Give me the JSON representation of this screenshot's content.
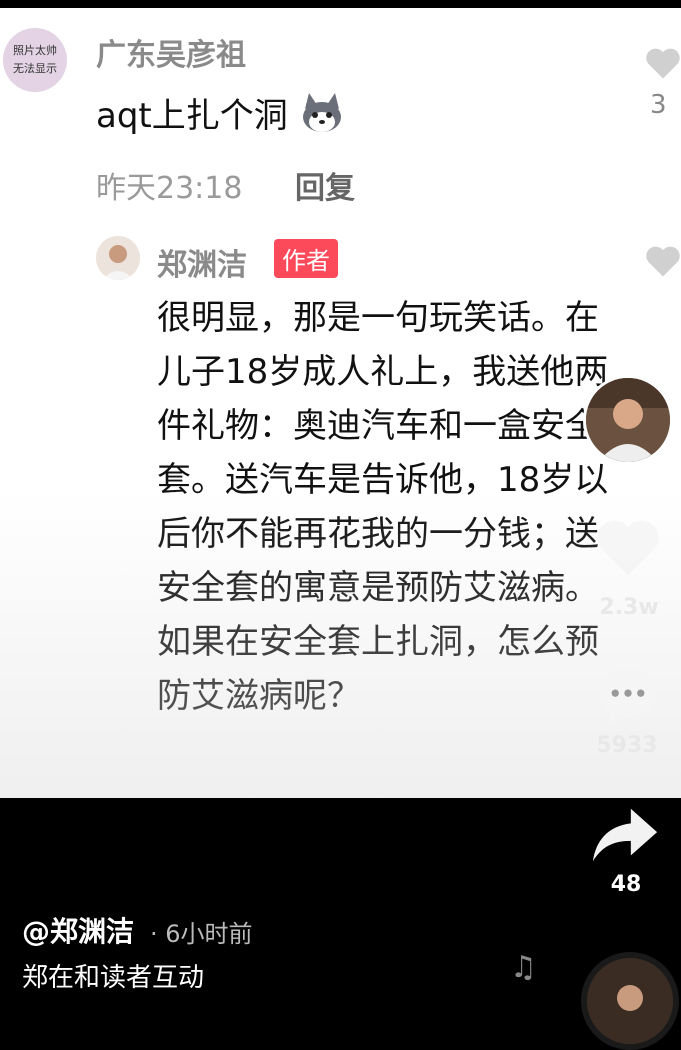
{
  "comment": {
    "avatar_text_line1": "照片太帅",
    "avatar_text_line2": "无法显示",
    "username": "广东吴彦祖",
    "text": "aqt上扎个洞",
    "time": "昨天23:18",
    "reply_label": "回复",
    "like_count": "3"
  },
  "reply": {
    "username": "郑渊洁",
    "badge": "作者",
    "text": "很明显，那是一句玩笑话。在儿子18岁成人礼上，我送他两件礼物：奥迪汽车和一盒安全套。送汽车是告诉他，18岁以后你不能再花我的一分钱；送安全套的寓意是预防艾滋病。如果在安全套上扎洞，怎么预防艾滋病呢？"
  },
  "sidebar": {
    "like_count": "2.3w",
    "comment_count": "5933",
    "share_count": "48"
  },
  "caption": {
    "username": "@郑渊洁",
    "time": "· 6小时前",
    "description": "郑在和读者互动"
  },
  "icons": {
    "comment_like": "heart-icon",
    "emoji": "husky-emoji",
    "video_like": "heart-icon",
    "comment": "comment-icon",
    "share": "share-arrow-icon",
    "music": "music-note-icon"
  },
  "colors": {
    "author_badge": "#fd4a5a",
    "background": "#000000"
  }
}
